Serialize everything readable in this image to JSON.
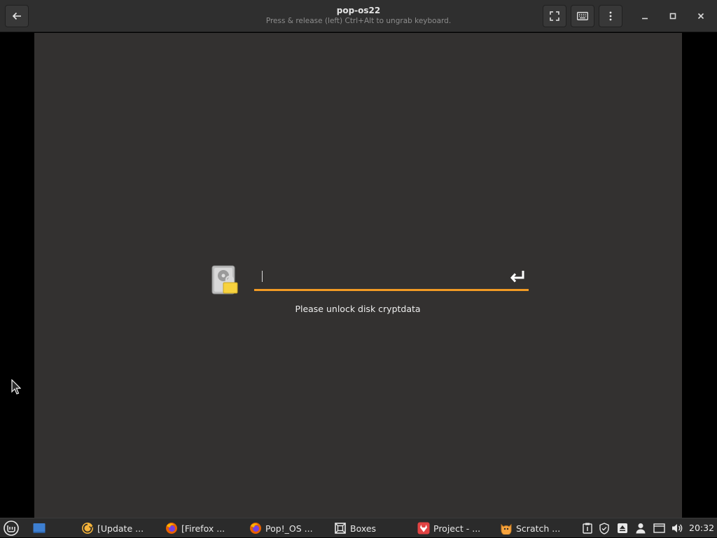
{
  "window": {
    "title": "pop-os22",
    "subtitle": "Press & release (left) Ctrl+Alt to ungrab keyboard."
  },
  "header_buttons": {
    "back_icon": "arrow-left-icon",
    "fullscreen_icon": "fullscreen-icon",
    "keyboard_icon": "keyboard-icon",
    "menu_icon": "vertical-dots-icon"
  },
  "vm": {
    "password_value": "",
    "message": "Please unlock disk cryptdata",
    "accent_color": "#f29b24",
    "background_color": "#333130"
  },
  "taskbar": {
    "items": [
      {
        "label": "[Update ...",
        "icon": "update-manager-icon"
      },
      {
        "label": "[Firefox ...",
        "icon": "firefox-icon"
      },
      {
        "label": "Pop!_OS ...",
        "icon": "firefox-icon"
      },
      {
        "label": "Boxes",
        "icon": "boxes-icon"
      },
      {
        "label": "Project - ...",
        "icon": "gitlab-icon"
      },
      {
        "label": "Scratch ...",
        "icon": "scratch-icon"
      }
    ],
    "clock": "20:32"
  }
}
